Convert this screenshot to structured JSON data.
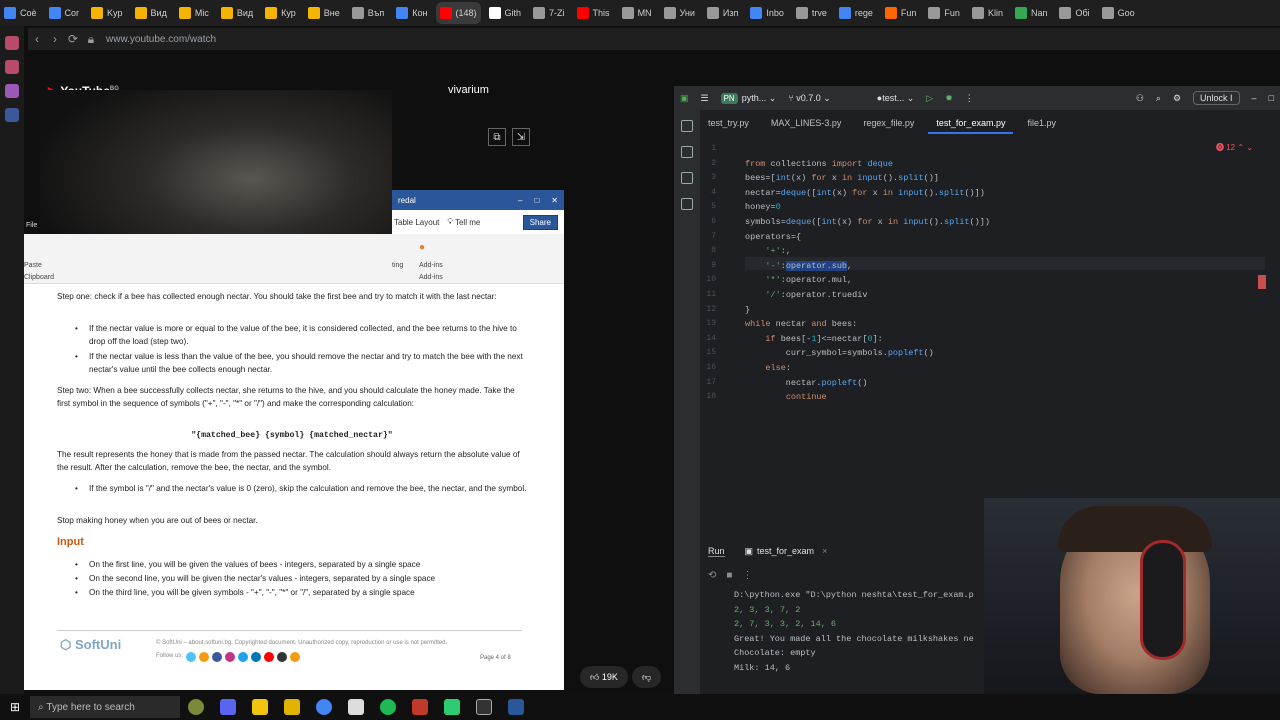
{
  "browser": {
    "tabs": [
      {
        "label": "Coè",
        "color": "#4285f4"
      },
      {
        "label": "Cor",
        "color": "#4285f4"
      },
      {
        "label": "Kyp",
        "color": "#f4b400"
      },
      {
        "label": "Вид",
        "color": "#f4b400"
      },
      {
        "label": "Mic",
        "color": "#f4b400"
      },
      {
        "label": "Вид",
        "color": "#f4b400"
      },
      {
        "label": "Кур",
        "color": "#f4b400"
      },
      {
        "label": "Вне",
        "color": "#f4b400"
      },
      {
        "label": "Въп",
        "color": "#999999"
      },
      {
        "label": "Кон",
        "color": "#4285f4"
      },
      {
        "label": "(148)",
        "color": "#ff0000",
        "active": true
      },
      {
        "label": "Gith",
        "color": "#ffffff"
      },
      {
        "label": "7-Zi",
        "color": "#999999"
      },
      {
        "label": "This",
        "color": "#ff0000"
      },
      {
        "label": "MN",
        "color": "#999999"
      },
      {
        "label": "Уни",
        "color": "#999999"
      },
      {
        "label": "Изп",
        "color": "#999999"
      },
      {
        "label": "Inbo",
        "color": "#4285f4"
      },
      {
        "label": "trve",
        "color": "#999999"
      },
      {
        "label": "rege",
        "color": "#4285f4"
      },
      {
        "label": "Fun",
        "color": "#ff6600"
      },
      {
        "label": "Fun",
        "color": "#999999"
      },
      {
        "label": "Klin",
        "color": "#999999"
      },
      {
        "label": "Nan",
        "color": "#34a853"
      },
      {
        "label": "Обі",
        "color": "#999999"
      },
      {
        "label": "Goo",
        "color": "#999999"
      }
    ],
    "address": "www.youtube.com/watch"
  },
  "youtube": {
    "logo": "YouTube",
    "logo_suffix": "BG",
    "channel_title": "vivarium",
    "likes": "19K"
  },
  "word": {
    "title_suffix": "redal",
    "ribbon_tabs": {
      "table_layout": "Table Layout",
      "tell_me": "Tell me",
      "share": "Share"
    },
    "ribbon_groups": {
      "file": "File",
      "paste": "Paste",
      "clipboard": "Clipboard",
      "editing": "ting",
      "addins": "Add-ins"
    },
    "doc": {
      "step1": "Step one: check if a bee has collected enough nectar. You should take the first bee and try to match it with the last nectar:",
      "step1_b1": "If the nectar value is more or equal to the value of the bee, it is considered collected, and the bee returns to the hive to drop off the load (step two).",
      "step1_b2": "If the nectar value is less than the value of the bee, you should remove the nectar and try to match the bee with the next nectar's value until the bee collects enough nectar.",
      "step2": "Step two: When a bee successfully collects nectar, she returns to the hive, and you should calculate the honey made. Take the first symbol in the sequence of symbols (\"+\", \"-\", \"*\" or \"/\") and make the corresponding calculation:",
      "formula": "\"{matched_bee} {symbol} {matched_nectar}\"",
      "result": "The result represents the honey that is made from the passed nectar. The calculation should always return the absolute value of the result. After the calculation, remove the bee, the nectar, and the symbol.",
      "result_b1": "If the symbol is \"/\" and the nectar's value is 0 (zero), skip the calculation and remove the bee, the nectar, and the symbol.",
      "stop": "Stop making honey when you are out of bees or nectar.",
      "input_heading": "Input",
      "in_b1": "On the first line, you will be given the values of bees - integers, separated by a single space",
      "in_b2": "On the second line, you will be given the nectar's values - integers, separated by a single space",
      "in_b3": "On the third line, you will be given symbols - \"+\", \"-\", \"*\" or \"/\", separated by a single space",
      "footer_logo": "SoftUni",
      "copyright": "© SoftUni – about.softuni.bg. Copyrighted document. Unauthorized copy, reproduction or use is not permitted.",
      "follow": "Follow us:",
      "page": "Page 4 of 8"
    }
  },
  "ide": {
    "project": "pyth...",
    "project_badge": "PN",
    "vcs": "v0.7.0",
    "run_config": "test...",
    "unlock": "Unlock I",
    "tabs": [
      "test_try.py",
      "MAX_LINES-3.py",
      "regex_file.py",
      "test_for_exam.py",
      "file1.py"
    ],
    "active_tab": 3,
    "error_count": "12",
    "line_numbers": [
      "1",
      "2",
      "3",
      "4",
      "5",
      "6",
      "7",
      "8",
      "9",
      "10",
      "11",
      "12",
      "13",
      "14",
      "15",
      "16",
      "17",
      "18"
    ],
    "code": [
      "",
      "from collections import deque",
      "bees=[int(x) for x in input().split()]",
      "nectar=deque([int(x) for x in input().split()])",
      "honey=0",
      "symbols=deque([int(x) for x in input().split()])",
      "operators={",
      "    '+':,",
      "    '-':operator.sub,",
      "    '*':operator.mul,",
      "    '/':operator.truediv",
      "}",
      "while nectar and bees:",
      "    if bees[-1]<=nectar[0]:",
      "        curr_symbol=symbols.popleft()",
      "    else:",
      "        nectar.popleft()",
      "        continue"
    ],
    "run": {
      "title": "Run",
      "tab": "test_for_exam",
      "output": [
        "D:\\python.exe \"D:\\python neshta\\test_for_exam.p",
        "2, 3, 3, 7, 2",
        "2, 7, 3, 3, 2, 14, 6",
        "Great! You made all the chocolate milkshakes ne",
        "Chocolate: empty",
        "Milk: 14, 6"
      ]
    }
  },
  "taskbar": {
    "search_placeholder": "Type here to search"
  }
}
